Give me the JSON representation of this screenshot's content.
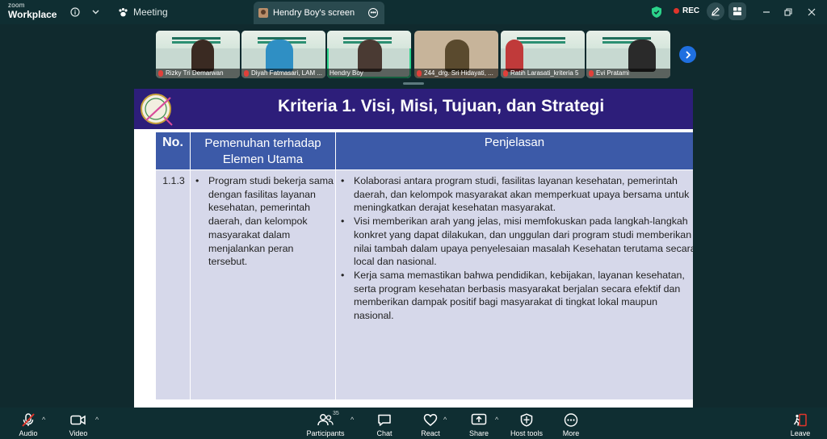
{
  "app": {
    "brand_top": "zoom",
    "brand_bottom": "Workplace"
  },
  "topbar": {
    "meeting_label": "Meeting",
    "share_tab_label": "Hendry Boy's screen",
    "rec_label": "REC",
    "rec_color": "#e0352b",
    "shield_color": "#2bd38a"
  },
  "participants_strip": [
    {
      "name": "Rizky Tri Demarwan",
      "muted": true
    },
    {
      "name": "Diyah Fatmasari, LAM ...",
      "muted": true
    },
    {
      "name": "Hendry Boy",
      "muted": false,
      "active": true
    },
    {
      "name": "244_drg. Sri Hidayati, ...",
      "muted": true
    },
    {
      "name": "Ratih Larasati_kriteria 5",
      "muted": true
    },
    {
      "name": "Evi Pratami",
      "muted": true
    }
  ],
  "slide": {
    "logo_text": "LAM Kes",
    "title": "Kriteria 1. Visi, Misi, Tujuan, dan Strategi",
    "header_color": "#2d1e7a",
    "table": {
      "headers": [
        "No.",
        "Pemenuhan terhadap Elemen Utama",
        "Penjelasan"
      ],
      "row": {
        "no": "1.1.3",
        "elemen": "Program studi bekerja sama dengan fasilitas layanan kesehatan, pemerintah daerah, dan kelompok masyarakat dalam menjalankan peran tersebut.",
        "penjelasan": [
          "Kolaborasi antara program studi, fasilitas layanan kesehatan, pemerintah daerah, dan kelompok masyarakat akan memperkuat upaya bersama untuk meningkatkan derajat kesehatan masyarakat.",
          "Visi memberikan arah yang jelas, misi memfokuskan pada langkah-langkah konkret yang dapat dilakukan, dan unggulan dari program studi memberikan nilai tambah dalam upaya penyelesaian masalah Kesehatan terutama secara local dan nasional.",
          "Kerja sama memastikan bahwa pendidikan, kebijakan, layanan kesehatan, serta program kesehatan berbasis masyarakat berjalan secara efektif dan memberikan dampak positif bagi masyarakat di tingkat lokal maupun nasional."
        ]
      }
    }
  },
  "bottombar": {
    "audio": "Audio",
    "video": "Video",
    "participants": "Participants",
    "participants_count": "35",
    "chat": "Chat",
    "react": "React",
    "share": "Share",
    "host_tools": "Host tools",
    "more": "More",
    "leave": "Leave",
    "leave_color": "#e0352b"
  }
}
